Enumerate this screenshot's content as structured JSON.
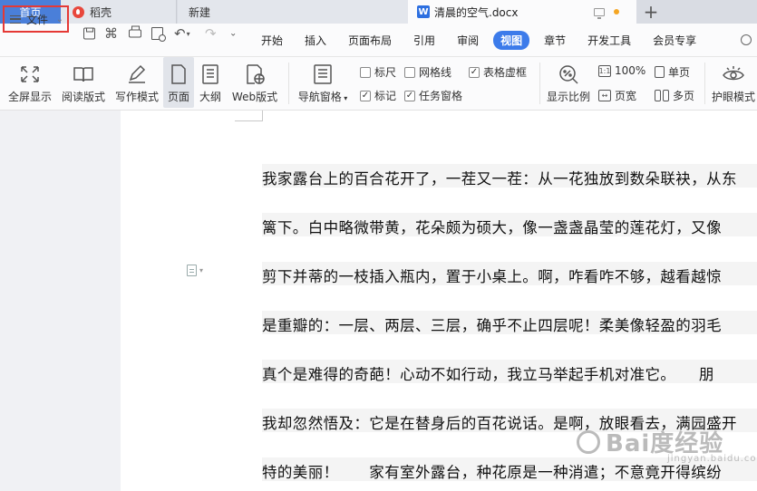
{
  "tabs": {
    "home": "首页",
    "docer": "稻壳",
    "new": "新建",
    "document": "清晨的空气.docx"
  },
  "toolbar": {
    "file_label": "文件"
  },
  "menu": [
    "开始",
    "插入",
    "页面布局",
    "引用",
    "审阅",
    "视图",
    "章节",
    "开发工具",
    "会员专享"
  ],
  "active_menu": "视图",
  "ribbon": {
    "fullscreen": "全屏显示",
    "reading": "阅读版式",
    "writing": "写作模式",
    "page": "页面",
    "outline": "大纲",
    "web": "Web版式",
    "nav_pane": "导航窗格",
    "ruler": "标尺",
    "gridlines": "网格线",
    "table_gridlines": "表格虚框",
    "marks": "标记",
    "task_pane": "任务窗格",
    "zoom_ratio": "显示比例",
    "hundred_percent": "100%",
    "page_width": "页宽",
    "single_page": "单页",
    "multi_page": "多页",
    "eye_protection": "护眼模式"
  },
  "checkboxes": {
    "ruler": false,
    "gridlines": false,
    "table_gridlines": true,
    "marks": true,
    "task_pane": true
  },
  "document": {
    "lines": [
      "我家露台上的百合花开了，一茬又一茬：从一花独放到数朵联袂，从东",
      "篱下。白中略微带黄，花朵颇为硕大，像一盏盏晶莹的莲花灯，又像",
      "剪下并蒂的一枝插入瓶内，置于小桌上。啊，咋看咋不够，越看越惊",
      "是重瓣的：一层、两层、三层，确乎不止四层呢！柔美像轻盈的羽毛",
      "真个是难得的奇葩！心动不如行动，我立马举起手机对准它。　　朋",
      "我却忽然悟及：它是在替身后的百花说话。是啊，放眼看去，满园盛开",
      "特的美丽！　　家有室外露台，种花原是一种消遣；不意竟开得缤纷"
    ]
  },
  "watermark": {
    "text": "Bai度经验",
    "sub": "jingyan.baidu.com"
  },
  "colors": {
    "accent": "#3c7bea",
    "home_tab": "#4a7fd9",
    "highlight_border": "#e53935"
  }
}
